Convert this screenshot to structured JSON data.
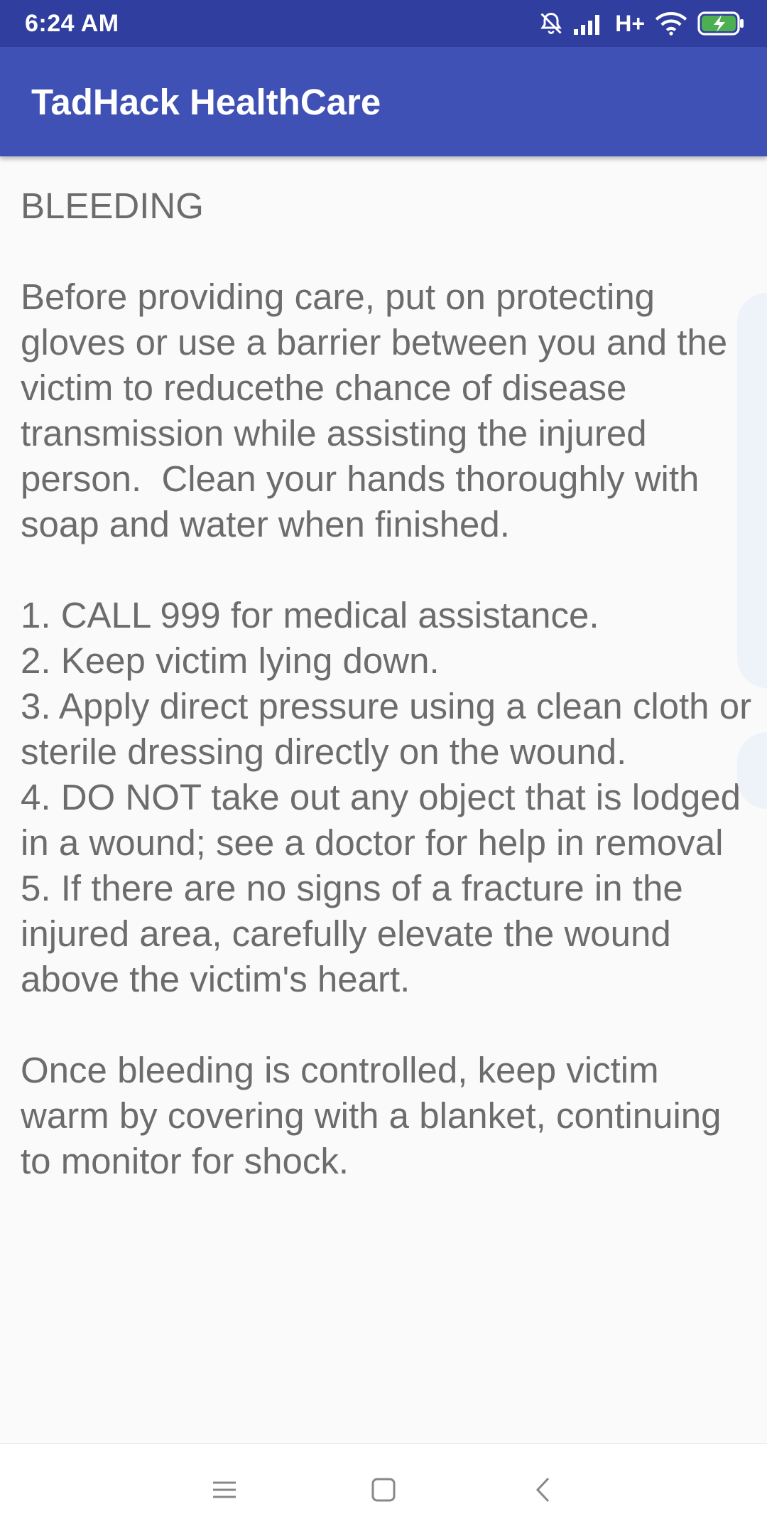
{
  "status_bar": {
    "time": "6:24 AM",
    "network": "H+",
    "icons": [
      "bell-muted-icon",
      "signal-icon",
      "wifi-icon",
      "battery-charging-icon"
    ],
    "background": "#303f9f"
  },
  "app_bar": {
    "title": "TadHack HealthCare",
    "background": "#3f51b5"
  },
  "article": {
    "heading": "BLEEDING",
    "intro": "Before providing care, put on protecting gloves or use a barrier between you and the victim to reducethe chance of disease transmission while assisting the injured person.  Clean your hands thoroughly with soap and water when finished.",
    "steps": [
      "1. CALL 999 for medical assistance.",
      "2. Keep victim lying down.",
      "3. Apply direct pressure using a clean cloth or sterile dressing directly on the wound.",
      "4. DO NOT take out any object that is lodged in a wound; see a doctor for help in removal",
      "5. If there are no signs of a fracture in the injured area, carefully elevate the wound above the victim's heart."
    ],
    "closing": "Once bleeding is controlled, keep victim warm by covering with a blanket, continuing to monitor for shock."
  },
  "nav_bar": {
    "icons": [
      "menu-icon",
      "home-icon",
      "back-icon"
    ]
  }
}
